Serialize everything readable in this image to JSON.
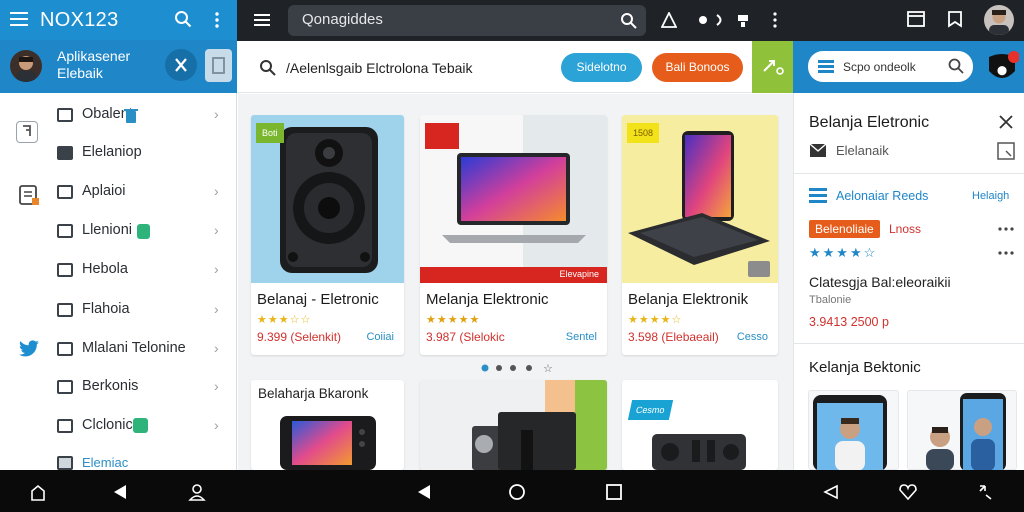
{
  "left": {
    "title": "NOX123",
    "account_name_line1": "Aplikasener",
    "account_name_line2": "Elebaik",
    "nav": [
      {
        "label": "Obalent",
        "has_chevron": true
      },
      {
        "label": "Elelaniop",
        "has_chevron": false
      },
      {
        "label": "Aplaioi",
        "has_chevron": true
      },
      {
        "label": "Llenioni",
        "has_chevron": true
      },
      {
        "label": "Hebola",
        "has_chevron": true
      },
      {
        "label": "Flahoia",
        "has_chevron": true
      },
      {
        "label": "Mlalani Telonine",
        "has_chevron": true
      },
      {
        "label": "Berkonis",
        "has_chevron": true
      },
      {
        "label": "Clclonic",
        "has_chevron": true
      },
      {
        "label": "Elemiac",
        "has_chevron": false
      }
    ]
  },
  "center": {
    "search_text": "Qonagiddes",
    "query": "/Aelenlsgaib Elctrolona Tebaik",
    "btn_primary": "Sidelotno",
    "btn_secondary": "Bali Bonoos",
    "products": [
      {
        "badge": "Boti",
        "title": "Belanaj - Eletronic",
        "price": "9.399 (Selenkit)",
        "ship": "Coiiai",
        "rating": 2.5,
        "banner": ""
      },
      {
        "badge": "",
        "title": "Melanja Elektronic",
        "price": "3.987 (Slelokic",
        "ship": "Sentel",
        "rating": 4.5,
        "banner": "Elevapine"
      },
      {
        "badge": "1508",
        "title": "Belanja Elektronik",
        "price": "3.598 (Elebaeail)",
        "ship": "Cesso",
        "rating": 4,
        "banner": ""
      }
    ],
    "second_row": {
      "card1_title": "Belaharja Bkaronk",
      "card3_badge": "Cesmo"
    },
    "carousel_pages": 5,
    "carousel_active": 1
  },
  "right": {
    "search_text": "Scpo ondeolk",
    "heading": "Belanja Eletronic",
    "subitem": "Elelanaik",
    "section_title": "Aelonaiar Reeds",
    "section_link": "Helaigh",
    "tag_label": "Belenoliaie",
    "tag_extra": "Lnoss",
    "rating": 3.5,
    "product_title": "Clatesgja Bal:eleoraikii",
    "product_sub": "Tbalonie",
    "product_price": "3.9413 2500 p",
    "section2_title": "Kelanja Bektonic"
  },
  "colors": {
    "accent_blue": "#1f86c8",
    "dark_bar": "#1f2327",
    "orange": "#e65c1a",
    "green": "#8fc13a",
    "star": "#e8b417",
    "price_red": "#d0312d"
  }
}
